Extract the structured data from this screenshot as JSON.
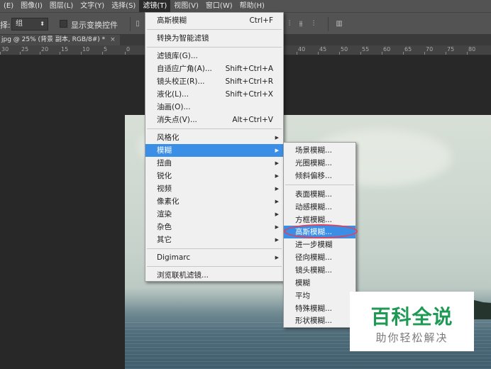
{
  "menubar": {
    "items": [
      {
        "label": "(E)"
      },
      {
        "label": "图像(I)"
      },
      {
        "label": "图层(L)"
      },
      {
        "label": "文字(Y)"
      },
      {
        "label": "选择(S)"
      },
      {
        "label": "滤镜(T)"
      },
      {
        "label": "视图(V)"
      },
      {
        "label": "窗口(W)"
      },
      {
        "label": "帮助(H)"
      }
    ]
  },
  "options_bar": {
    "label": "择:",
    "select_value": "组",
    "checkbox_label": "显示变换控件"
  },
  "document_tab": {
    "title": "jpg @ 25% (背景 副本, RGB/8#) *",
    "close": "×"
  },
  "ruler": {
    "ticks": [
      "30",
      "25",
      "20",
      "15",
      "10",
      "5",
      "0",
      "40",
      "45",
      "50",
      "55",
      "60",
      "65",
      "70",
      "75",
      "80"
    ]
  },
  "filter_menu": {
    "items": [
      {
        "label": "高斯模糊",
        "shortcut": "Ctrl+F"
      },
      {
        "label": "转换为智能滤镜",
        "shortcut": ""
      },
      {
        "label": "滤镜库(G)...",
        "shortcut": ""
      },
      {
        "label": "自适应广角(A)...",
        "shortcut": "Shift+Ctrl+A"
      },
      {
        "label": "镜头校正(R)...",
        "shortcut": "Shift+Ctrl+R"
      },
      {
        "label": "液化(L)...",
        "shortcut": "Shift+Ctrl+X"
      },
      {
        "label": "油画(O)...",
        "shortcut": ""
      },
      {
        "label": "消失点(V)...",
        "shortcut": "Alt+Ctrl+V"
      },
      {
        "label": "风格化",
        "shortcut": ""
      },
      {
        "label": "模糊",
        "shortcut": ""
      },
      {
        "label": "扭曲",
        "shortcut": ""
      },
      {
        "label": "锐化",
        "shortcut": ""
      },
      {
        "label": "视频",
        "shortcut": ""
      },
      {
        "label": "像素化",
        "shortcut": ""
      },
      {
        "label": "渲染",
        "shortcut": ""
      },
      {
        "label": "杂色",
        "shortcut": ""
      },
      {
        "label": "其它",
        "shortcut": ""
      },
      {
        "label": "Digimarc",
        "shortcut": ""
      },
      {
        "label": "浏览联机滤镜...",
        "shortcut": ""
      }
    ]
  },
  "blur_submenu": {
    "items": [
      {
        "label": "场景模糊..."
      },
      {
        "label": "光圈模糊..."
      },
      {
        "label": "倾斜偏移..."
      },
      {
        "label": "表面模糊..."
      },
      {
        "label": "动感模糊..."
      },
      {
        "label": "方框模糊..."
      },
      {
        "label": "高斯模糊..."
      },
      {
        "label": "进一步模糊"
      },
      {
        "label": "径向模糊..."
      },
      {
        "label": "镜头模糊..."
      },
      {
        "label": "模糊"
      },
      {
        "label": "平均"
      },
      {
        "label": "特殊模糊..."
      },
      {
        "label": "形状模糊..."
      }
    ]
  },
  "watermark": {
    "title": "百科全说",
    "subtitle": "助你轻松解决"
  },
  "colors": {
    "menu_highlight": "#3a8ee6",
    "annotation_ring": "#d94560",
    "watermark_green": "#1f9a55"
  }
}
